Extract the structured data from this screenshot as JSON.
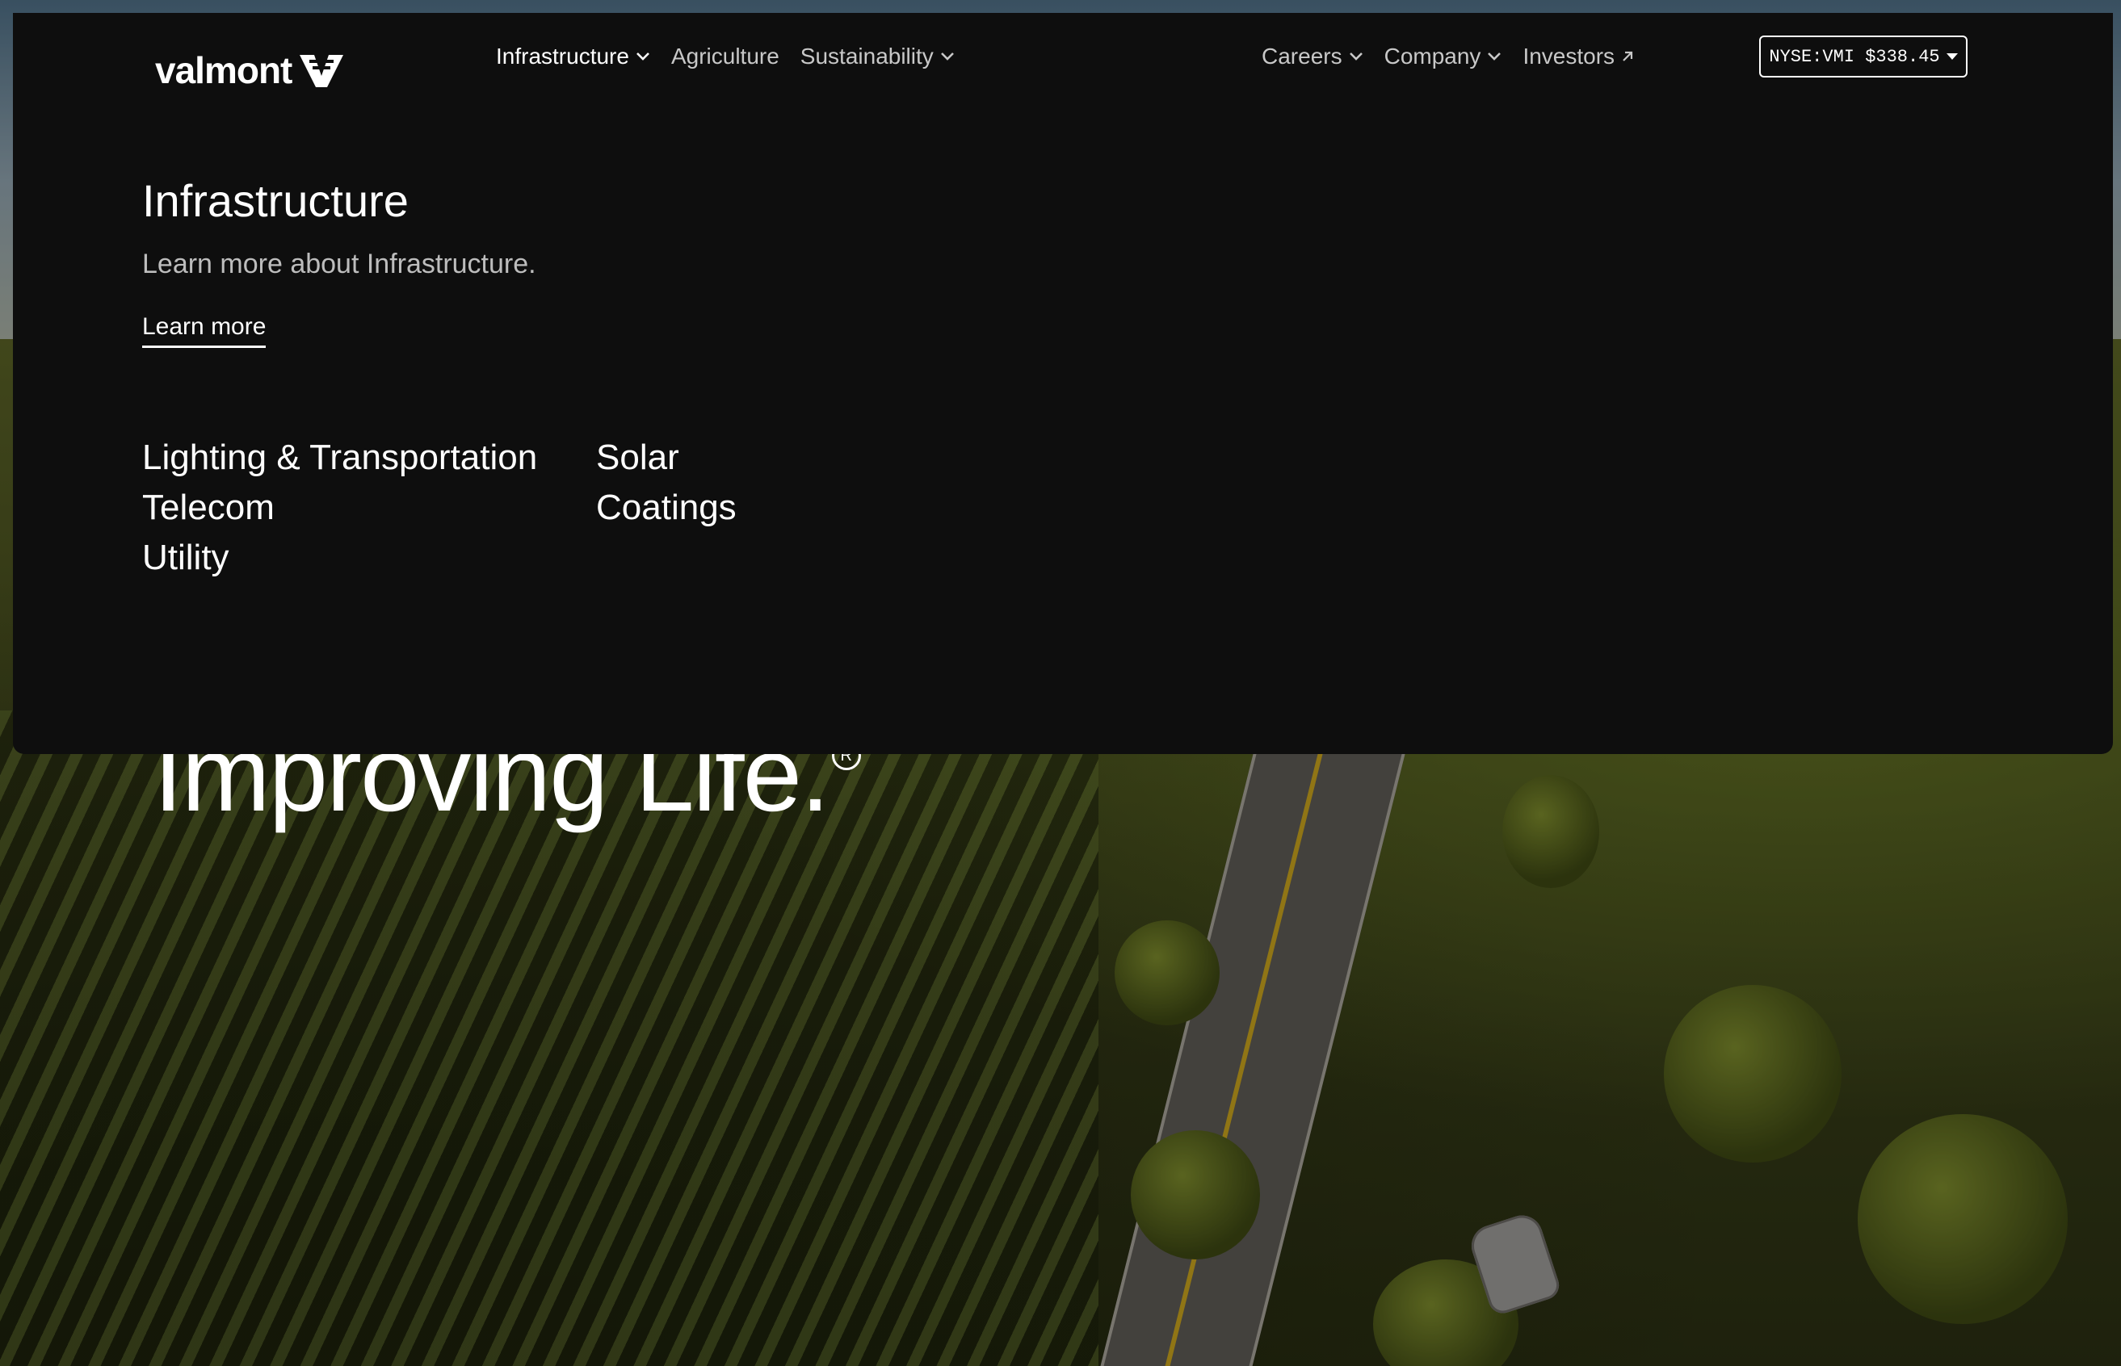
{
  "brand": {
    "logo_text": "valmont"
  },
  "nav": {
    "primary": [
      {
        "label": "Infrastructure",
        "has_dropdown": true,
        "active": true
      },
      {
        "label": "Agriculture",
        "has_dropdown": false,
        "active": false
      },
      {
        "label": "Sustainability",
        "has_dropdown": true,
        "active": false
      }
    ],
    "secondary": [
      {
        "label": "Careers",
        "has_dropdown": true,
        "icon": "chevron-down-icon"
      },
      {
        "label": "Company",
        "has_dropdown": true,
        "icon": "chevron-down-icon"
      },
      {
        "label": "Investors",
        "has_dropdown": false,
        "icon": "external-arrow-icon"
      }
    ],
    "search_icon": "search-icon"
  },
  "stock": {
    "label": "NYSE:VMI $338.45"
  },
  "mega_menu": {
    "title": "Infrastructure",
    "description": "Learn more about Infrastructure.",
    "learn_more": "Learn more",
    "links_col1": [
      "Lighting & Transportation",
      "Telecom",
      "Utility"
    ],
    "links_col2": [
      "Solar",
      "Coatings"
    ]
  },
  "hero": {
    "headline": "Improving Life.",
    "registered_mark": "R"
  },
  "colors": {
    "panel_bg": "#0e0e0e",
    "text_primary": "#ffffff",
    "text_muted": "#bdbdbd"
  }
}
